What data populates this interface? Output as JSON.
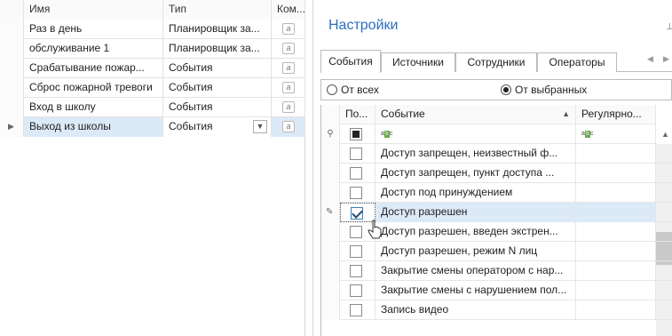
{
  "left_grid": {
    "columns": [
      "Имя",
      "Тип",
      "Ком..."
    ],
    "rows": [
      {
        "name": "Раз в день",
        "type": "Планировщик за...",
        "comment_icon": "memo-icon"
      },
      {
        "name": "обслуживание 1",
        "type": "Планировщик за...",
        "comment_icon": "memo-icon"
      },
      {
        "name": "Срабатывание пожар...",
        "type": "События",
        "comment_icon": "memo-icon"
      },
      {
        "name": "Сброс пожарной тревоги",
        "type": "События",
        "comment_icon": "memo-icon"
      },
      {
        "name": "Вход в школу",
        "type": "События",
        "comment_icon": "memo-icon"
      },
      {
        "name": "Выход из школы",
        "type": "События",
        "comment_icon": "memo-icon",
        "selected": true
      }
    ]
  },
  "settings": {
    "title": "Настройки",
    "tabs": [
      "События",
      "Источники",
      "Сотрудники",
      "Операторы"
    ],
    "active_tab": "События",
    "radio_all": "От всех",
    "radio_selected": "От выбранных",
    "radio_checked": "От выбранных",
    "events_grid": {
      "columns": [
        "По...",
        "Событие",
        "Регулярно..."
      ],
      "filter_placeholder": "a b c",
      "rows": [
        {
          "event": "Доступ запрещен, неизвестный ф...",
          "checked": false
        },
        {
          "event": "Доступ запрещен, пункт доступа ...",
          "checked": false
        },
        {
          "event": "Доступ под принуждением",
          "checked": false
        },
        {
          "event": "Доступ разрешен",
          "checked": true,
          "selected": true
        },
        {
          "event": "Доступ разрешен, введен экстрен...",
          "checked": false
        },
        {
          "event": "Доступ разрешен, режим N лиц",
          "checked": false
        },
        {
          "event": "Закрытие смены оператором с нар...",
          "checked": false
        },
        {
          "event": "Закрытие смены с нарушением пол...",
          "checked": false
        },
        {
          "event": "Запись видео",
          "checked": false
        }
      ]
    }
  },
  "colors": {
    "accent": "#2a6fc0",
    "selection": "#dce9f7"
  }
}
